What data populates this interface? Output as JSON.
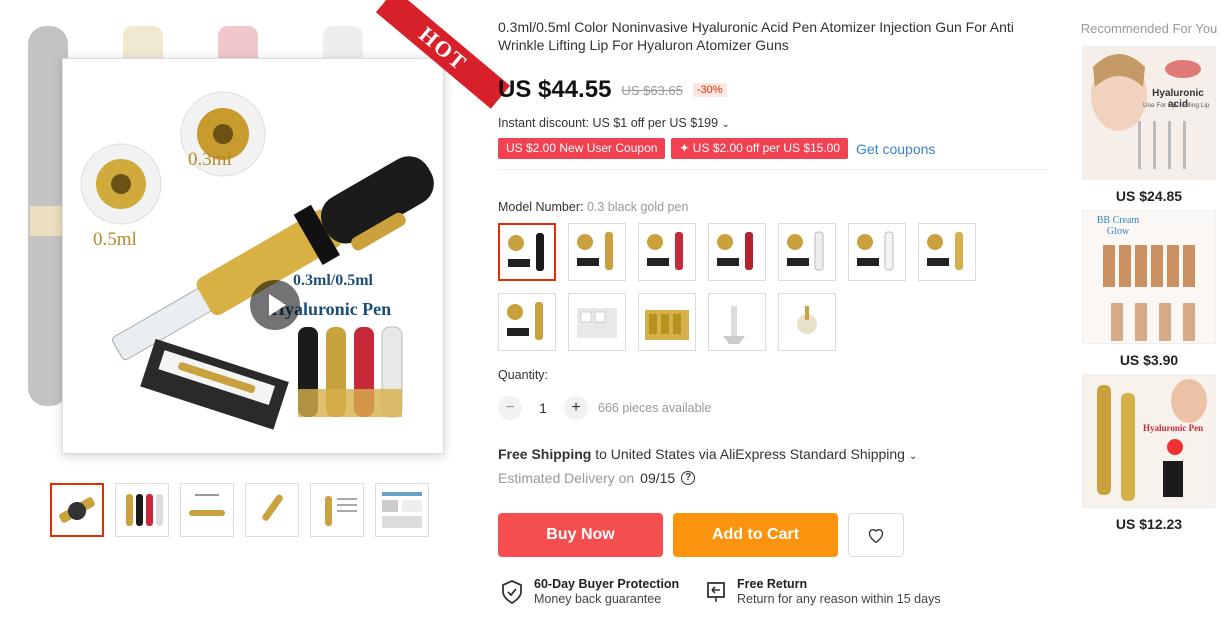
{
  "gallery": {
    "ribbon": "HOT",
    "main_text": {
      "size1": "0.3ml",
      "size2": "0.5ml",
      "banner1": "0.3ml/0.5ml",
      "banner2": "Hyaluronic Pen"
    }
  },
  "product": {
    "title": "0.3ml/0.5ml Color Noninvasive Hyaluronic Acid Pen Atomizer Injection Gun For Anti Wrinkle Lifting Lip For Hyaluron Atomizer Guns",
    "price": "US $44.55",
    "old_price": "US $63.65",
    "discount": "-30%",
    "instant_discount": "Instant discount: US $1 off per US $199",
    "coupons": [
      "US $2.00 New User Coupon",
      "✦ US $2.00 off per US $15.00"
    ],
    "get_coupons": "Get coupons",
    "model_label": "Model Number:",
    "model_value": "0.3 black gold pen",
    "variants_count": 13,
    "quantity_label": "Quantity:",
    "quantity_minus": "−",
    "quantity_value": "1",
    "quantity_plus": "+",
    "available": "666 pieces available",
    "shipping_bold": "Free Shipping",
    "shipping_rest": " to United States via AliExpress Standard Shipping",
    "delivery_label": "Estimated Delivery on",
    "delivery_date": "09/15",
    "help_glyph": "?",
    "buy_now": "Buy Now",
    "add_to_cart": "Add to Cart",
    "protection_title": "60-Day Buyer Protection",
    "protection_sub": "Money back guarantee",
    "return_title": "Free Return",
    "return_sub": "Return for any reason within 15 days"
  },
  "recommended": {
    "title": "Recommended For You",
    "items": [
      {
        "price": "US $24.85",
        "caption": "Hyaluronic acid",
        "sub": "Use For Lip   Filling Lip"
      },
      {
        "price": "US $3.90",
        "caption": "BB Cream Glow"
      },
      {
        "price": "US $12.23",
        "caption": "Hyaluronic Pen"
      }
    ]
  },
  "colors": {
    "accent": "#e62e04",
    "buy": "#f44e4e",
    "cart": "#fb930f",
    "coupon": "#f24150",
    "link": "#3a83c7"
  }
}
